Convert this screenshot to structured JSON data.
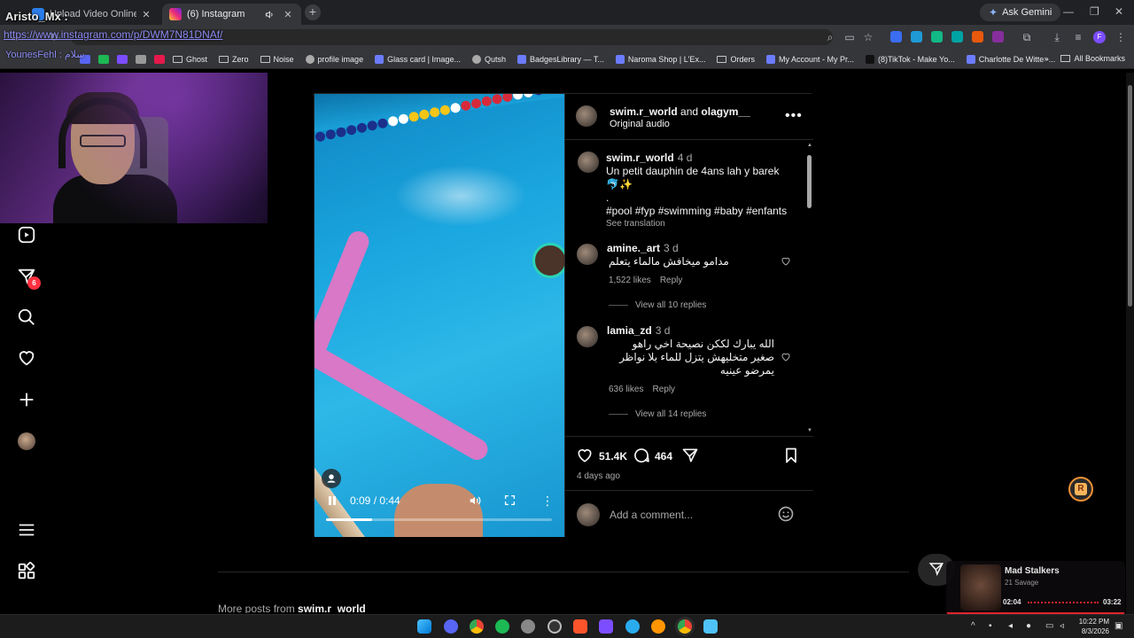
{
  "overlay": {
    "streamer_name": "Aristo_Mx :",
    "url_text": "https://www.instagram.com/p/DWM7N81DNAf/",
    "chat_text": "YounesFehl : سلام"
  },
  "tabs": [
    {
      "label": "Upload Video Online - Free Vi",
      "active": false
    },
    {
      "label": "(6) Instagram",
      "active": true
    }
  ],
  "toolbar": {
    "gemini_label": "Ask Gemini"
  },
  "bookmarks": [
    {
      "label": "Ghost",
      "icon": "folder"
    },
    {
      "label": "Zero",
      "icon": "folder"
    },
    {
      "label": "Noise",
      "icon": "folder"
    },
    {
      "label": "profile image",
      "icon": "globe"
    },
    {
      "label": "Glass card | Image...",
      "icon": "site"
    },
    {
      "label": "Qutsh",
      "icon": "globe"
    },
    {
      "label": "BadgesLibrary — T...",
      "icon": "site"
    },
    {
      "label": "Naroma Shop | L'Ex...",
      "icon": "site"
    },
    {
      "label": "Orders",
      "icon": "folder"
    },
    {
      "label": "My Account - My Pr...",
      "icon": "site"
    },
    {
      "label": "(8)TikTok - Make Yo...",
      "icon": "tiktok"
    },
    {
      "label": "Charlotte De Witte -...",
      "icon": "site"
    }
  ],
  "all_bookmarks_label": "All Bookmarks",
  "sidebar": {
    "notification_count": "6"
  },
  "post": {
    "author": "swim.r_world",
    "and_text": "and",
    "coauthor": "olagym__",
    "audio": "Original audio",
    "video": {
      "time": "0:09 / 0:44",
      "progress": 0.2045
    },
    "caption": {
      "author": "swim.r_world",
      "time": "4 d",
      "text": "Un petit dauphin de 4ans lah y barek 🐬✨",
      "dot": ".",
      "hashtags": "#pool #fyp #swimming #baby #enfants",
      "see_translation": "See translation"
    },
    "comments": [
      {
        "user": "amine._art",
        "time": "3 d",
        "text": "مدامو ميخافش مالماء يتعلم",
        "likes": "1,522 likes",
        "reply": "Reply",
        "view_replies": "View all 10 replies"
      },
      {
        "user": "lamia_zd",
        "time": "3 d",
        "text": "الله يبارك لككن نصيحة اخي راهو صغير متخليهش يتزل للماء بلا نواظر يمرضو عينيه",
        "likes": "636 likes",
        "reply": "Reply",
        "view_replies": "View all 14 replies"
      }
    ],
    "likes_count": "51.4K",
    "comments_count": "464",
    "posted": "4 days ago",
    "add_comment_placeholder": "Add a comment..."
  },
  "more_posts": {
    "prefix": "More posts from",
    "user": "swim.r_world"
  },
  "media_widget": {
    "title": "Mad Stalkers",
    "artist": "21 Savage",
    "elapsed": "02:04",
    "duration": "03:22"
  },
  "taskbar": {
    "time": "10:22 PM",
    "date": "8/3/2026"
  },
  "colors": {
    "accent_red": "#ff3040",
    "link_blue": "#e0f1ff",
    "chrome_bg": "#35363a"
  }
}
